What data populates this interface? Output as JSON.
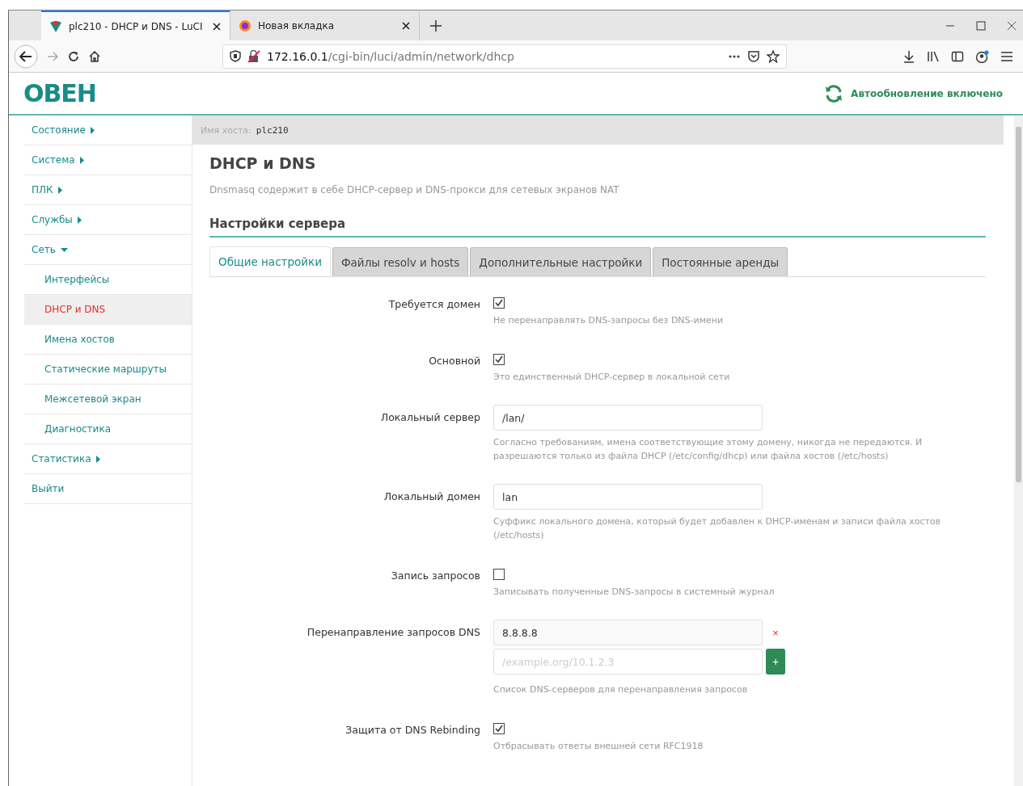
{
  "browser": {
    "tabs": [
      {
        "title": "plc210 - DHCP и DNS - LuCI",
        "selected": true,
        "kind": "site"
      },
      {
        "title": "Новая вкладка",
        "selected": false,
        "kind": "newtab"
      }
    ],
    "url_host": "172.16.0.1",
    "url_path": "/cgi-bin/luci/admin/network/dhcp"
  },
  "header": {
    "logo": "ОВЕН",
    "autorefresh": "Автообновление включено"
  },
  "sidebar": {
    "items": [
      {
        "label": "Состояние",
        "expanded": false,
        "selected": false
      },
      {
        "label": "Система",
        "expanded": false,
        "selected": false
      },
      {
        "label": "ПЛК",
        "expanded": false,
        "selected": false
      },
      {
        "label": "Службы",
        "expanded": false,
        "selected": false
      },
      {
        "label": "Сеть",
        "expanded": true,
        "selected": false,
        "children": [
          {
            "label": "Интерфейсы",
            "selected": false
          },
          {
            "label": "DHCP и DNS",
            "selected": true
          },
          {
            "label": "Имена хостов",
            "selected": false
          },
          {
            "label": "Статические маршруты",
            "selected": false
          },
          {
            "label": "Межсетевой экран",
            "selected": false
          },
          {
            "label": "Диагностика",
            "selected": false
          }
        ]
      },
      {
        "label": "Статистика",
        "expanded": false,
        "selected": false
      },
      {
        "label": "Выйти",
        "selected": false
      }
    ]
  },
  "hostname": {
    "label": "Имя хоста:",
    "value": "plc210"
  },
  "page": {
    "title": "DHCP и DNS",
    "description": "Dnsmasq содержит в себе DHCP-сервер и DNS-прокси для сетевых экранов NAT",
    "section": "Настройки сервера"
  },
  "tabs": [
    {
      "label": "Общие настройки",
      "selected": true
    },
    {
      "label": "Файлы resolv и hosts",
      "selected": false
    },
    {
      "label": "Дополнительные настройки",
      "selected": false
    },
    {
      "label": "Постоянные аренды",
      "selected": false
    }
  ],
  "fields": [
    {
      "kind": "checkbox",
      "label": "Требуется домен",
      "checked": true,
      "hint": "Не перенаправлять DNS-запросы без DNS-имени"
    },
    {
      "kind": "checkbox",
      "label": "Основной",
      "checked": true,
      "hint": "Это единственный DHCP-сервер в локальной сети"
    },
    {
      "kind": "text",
      "label": "Локальный сервер",
      "value": "/lan/",
      "hint": "Согласно требованиям, имена соответствующие этому домену, никогда не передаются. И разрешаются только из файла DHCP (/etc/config/dhcp) или файла хостов (/etc/hosts)"
    },
    {
      "kind": "text",
      "label": "Локальный домен",
      "value": "lan",
      "hint": "Суффикс локального домена, который будет добавлен к DHCP-именам и записи файла хостов (/etc/hosts)"
    },
    {
      "kind": "checkbox",
      "label": "Запись запросов",
      "checked": false,
      "hint": "Записывать полученные DNS-запросы в системный журнал"
    },
    {
      "kind": "list",
      "label": "Перенаправление запросов DNS",
      "values": [
        "8.8.8.8"
      ],
      "remove": "×",
      "placeholder": "/example.org/10.1.2.3",
      "add": "+",
      "hint": "Список DNS-серверов для перенаправления запросов"
    },
    {
      "kind": "checkbox",
      "label": "Защита от DNS Rebinding",
      "checked": true,
      "hint": "Отбрасывать ответы внешней сети RFC1918"
    }
  ]
}
